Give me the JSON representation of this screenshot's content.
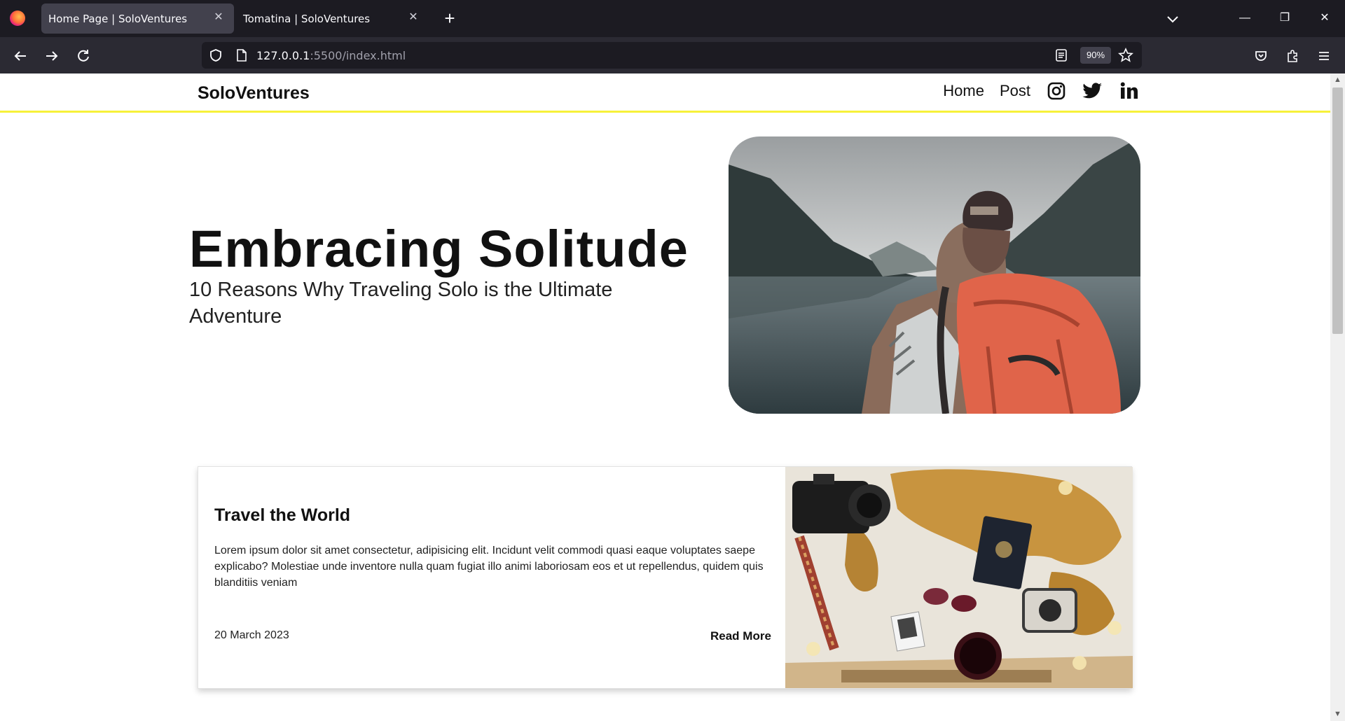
{
  "browser": {
    "tabs": [
      {
        "title": "Home Page | SoloVentures",
        "active": true
      },
      {
        "title": "Tomatina | SoloVentures",
        "active": false
      }
    ],
    "url_host": "127.0.0.1",
    "url_rest": ":5500/index.html",
    "zoom": "90%",
    "icons": {
      "firefox": "firefox-logo-icon",
      "back": "arrow-left-icon",
      "forward": "arrow-right-icon",
      "reload": "reload-icon",
      "shield": "shield-icon",
      "page": "page-icon",
      "reader": "reader-view-icon",
      "bookmark": "star-icon",
      "pocket": "pocket-icon",
      "extensions": "puzzle-icon",
      "menu": "hamburger-icon"
    }
  },
  "site": {
    "brand": "SoloVentures",
    "nav": {
      "home": "Home",
      "post": "Post",
      "social": [
        "instagram-icon",
        "twitter-icon",
        "linkedin-icon"
      ]
    },
    "hero": {
      "title": "Embracing Solitude",
      "subtitle": "10 Reasons Why Traveling Solo is the Ultimate Adventure"
    },
    "card": {
      "title": "Travel the World",
      "body": "Lorem ipsum dolor sit amet consectetur, adipisicing elit. Incidunt velit commodi quasi eaque voluptates saepe explicabo? Molestiae unde inventore nulla quam fugiat illo animi laboriosam eos et ut repellendus, quidem quis blanditiis veniam",
      "date": "20 March 2023",
      "read_more": "Read More"
    },
    "colors": {
      "header_underline": "#f7f13a",
      "backpack": "#e0644a"
    }
  }
}
